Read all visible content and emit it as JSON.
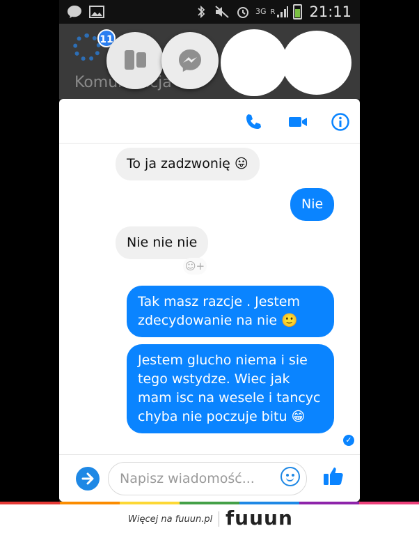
{
  "status_bar": {
    "time": "21:11",
    "network": "3G",
    "roaming": "R"
  },
  "app_bar": {
    "notification_count": "11",
    "tab_label": "Komunikacja"
  },
  "chat": {
    "messages": [
      {
        "direction": "in",
        "text": "To ja zadzwonię 😛"
      },
      {
        "direction": "out",
        "text": "Nie"
      },
      {
        "direction": "in",
        "text": "Nie nie nie"
      },
      {
        "direction": "out",
        "text": "Tak masz razcje . Jestem zdecydowanie na nie 🙂"
      },
      {
        "direction": "out",
        "text": "Jestem glucho niema i sie tego wstydze. Wiec jak mam isc na wesele i tancyc chyba nie poczuje bitu 😁"
      }
    ]
  },
  "composer": {
    "placeholder": "Napisz wiadomość..."
  },
  "footer": {
    "promo_text": "Więcej na fuuun.pl",
    "logo_text": "fuuun"
  },
  "colors": {
    "messenger_blue": "#0a84ff",
    "incoming_bubble": "#f0f0f0",
    "brand_stripe": [
      "#e53935",
      "#fb8c00",
      "#fdd835",
      "#43a047",
      "#1e88e5",
      "#8e24aa",
      "#ec407a"
    ]
  }
}
